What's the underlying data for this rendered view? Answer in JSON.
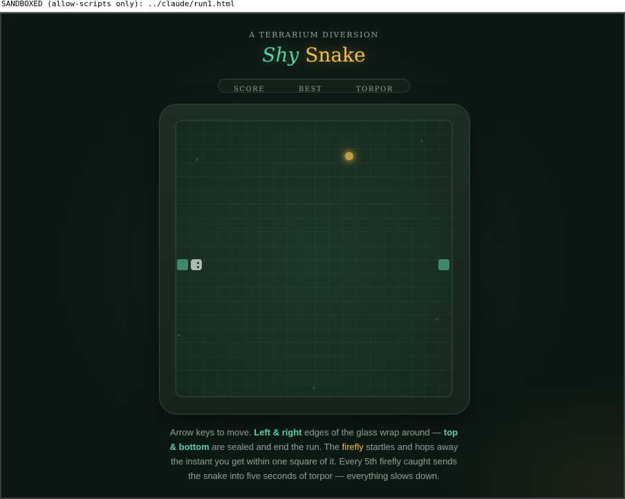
{
  "sandbox_banner": "SANDBOXED (allow-scripts only): ../claude/run1.html",
  "header": {
    "eyebrow": "A TERRARIUM DIVERSION",
    "title_italic": "Shy",
    "title_main": "Snake"
  },
  "stats": {
    "score_label": "SCORE",
    "best_label": "BEST",
    "torpor_label": "TORPOR"
  },
  "game": {
    "grid_cells": 20,
    "snake": [
      {
        "col": 0,
        "row": 10
      },
      {
        "col": 1,
        "row": 10
      },
      {
        "col": 19,
        "row": 10
      }
    ],
    "head_index": 1,
    "firefly": {
      "col": 12,
      "row": 2
    },
    "colors": {
      "snake": "#4faa84",
      "snake_head": "#ddeee6",
      "firefly": "#f6c34f",
      "board": "#1a3026",
      "accent_green": "#5fcfa4",
      "accent_gold": "#f2c04f"
    }
  },
  "instructions": {
    "p1": "Arrow keys to move. ",
    "lr": "Left & right",
    "p2": " edges of the glass wrap around — ",
    "tb": "top & bottom",
    "p3": " are sealed and end the run. The ",
    "ff": "firefly",
    "p4": " startles and hops away the instant you get within one square of it. Every 5th firefly caught sends the snake into five seconds of torpor — everything slows down."
  }
}
